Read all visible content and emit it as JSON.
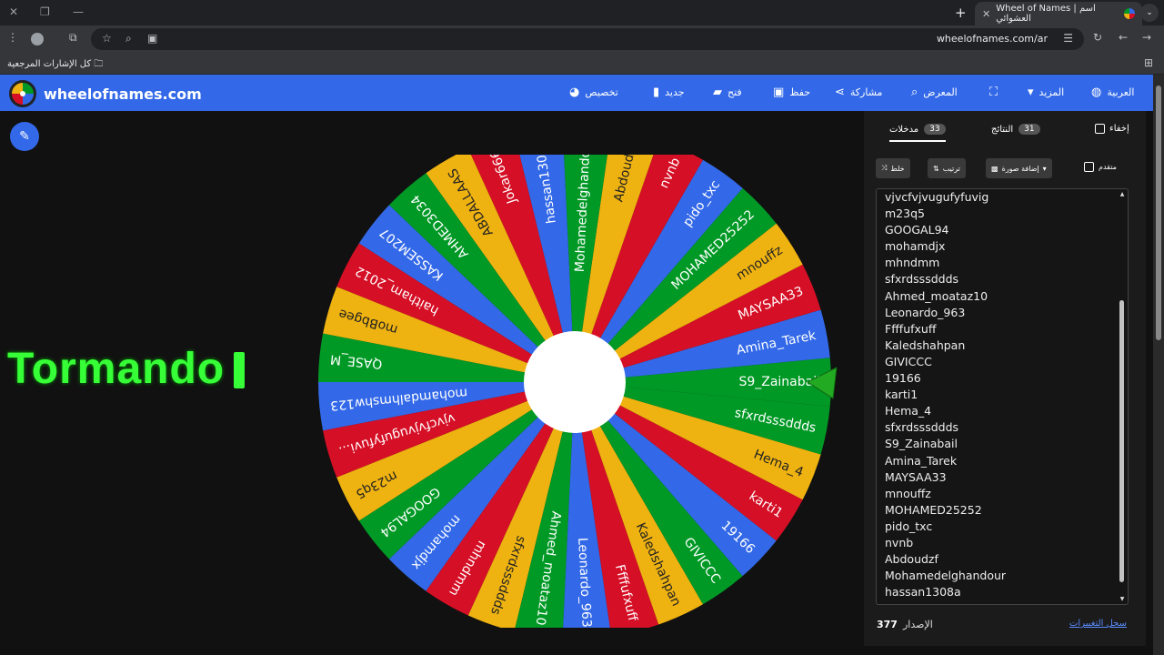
{
  "browser": {
    "tab_title": "Wheel of Names | اسم العشوائي",
    "url": "wheelofnames.com/ar",
    "bookmarks_label": "كل الإشارات المرجعية"
  },
  "site": {
    "brand": "wheelofnames.com",
    "nav": {
      "language": "العربية",
      "more": "المزيد",
      "gallery": "المعرض",
      "share": "مشاركة",
      "save": "حفظ",
      "open": "فتح",
      "new": "جديد",
      "customize": "تخصيص"
    }
  },
  "winner_text": "Tormando",
  "panel": {
    "entries_tab": "مدخلات",
    "entries_count": "33",
    "results_tab": "النتائج",
    "results_count": "31",
    "hide_label": "إخفاء",
    "shuffle_label": "خلط",
    "sort_label": "ترتيب",
    "add_image_label": "إضافة صورة",
    "advanced_label": "متقدم",
    "version_label": "الإصدار",
    "version_number": "377",
    "changelog_label": "سجل التغييرات"
  },
  "entries": [
    "vjvcfvjvugufyfuvig",
    "m23q5",
    "GOOGAL94",
    "mohamdjx",
    "mhndmm",
    "sfxrdsssddds",
    "Ahmed_moataz10",
    "Leonardo_963",
    "Ffffufxuff",
    "Kaledshahpan",
    "GIVICCC",
    "19166",
    "karti1",
    "Hema_4",
    "sfxrdsssddds",
    "S9_Zainabail",
    "Amina_Tarek",
    "MAYSAA33",
    "mnouffz",
    "MOHAMED25252",
    "pido_txc",
    "nvnb",
    "Abdoudzf",
    "Mohamedelghandour",
    "hassan1308a"
  ],
  "wheel": {
    "segments": [
      "S9_Zainabail",
      "Amina_Tarek",
      "MAYSAA33",
      "mnouffz",
      "MOHAMED25252",
      "pido_txc",
      "nvnb",
      "Abdoudzf",
      "Mohamedelghandour",
      "hassan1308a",
      "Jokar666",
      "ABDALLAAS",
      "AHMED3034",
      "KASSEM207",
      "haitham_2012",
      "moBbgee",
      "QASE_M",
      "mohamdalhmshw123",
      "vjvcfvjvugufyfuvi...",
      "m23q5",
      "GOOGAL94",
      "mohamdjx",
      "mhndmm",
      "sfxrdsssddds",
      "Ahmed_moataz10",
      "Leonardo_963",
      "Ffffufxuff",
      "Kaledshahpan",
      "GIVICCC",
      "19166",
      "karti1",
      "Hema_4",
      "sfxrdsssddds"
    ],
    "colors": [
      "#009925",
      "#3369e8",
      "#d50f25",
      "#eeb211"
    ]
  }
}
